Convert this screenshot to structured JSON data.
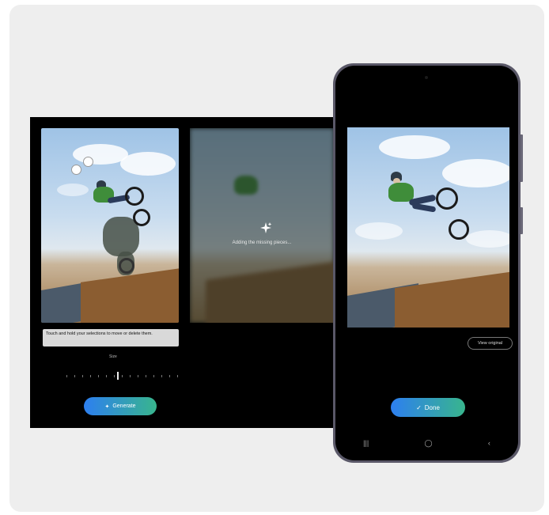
{
  "editor": {
    "status_text": "Adding the missing pieces...",
    "hint_text": "Touch and hold your selections to move or delete them.",
    "size_label": "Size",
    "generate_label": "Generate"
  },
  "phone": {
    "view_original_label": "View original",
    "done_label": "Done",
    "nav": {
      "recents": "|||",
      "home": "◯",
      "back": "‹"
    }
  },
  "colors": {
    "accent_start": "#2d7ff0",
    "accent_end": "#38b58d",
    "background": "#eeeeee"
  },
  "icons": [
    "sparkle-icon",
    "check-icon",
    "undo-icon",
    "lightbulb-icon"
  ]
}
